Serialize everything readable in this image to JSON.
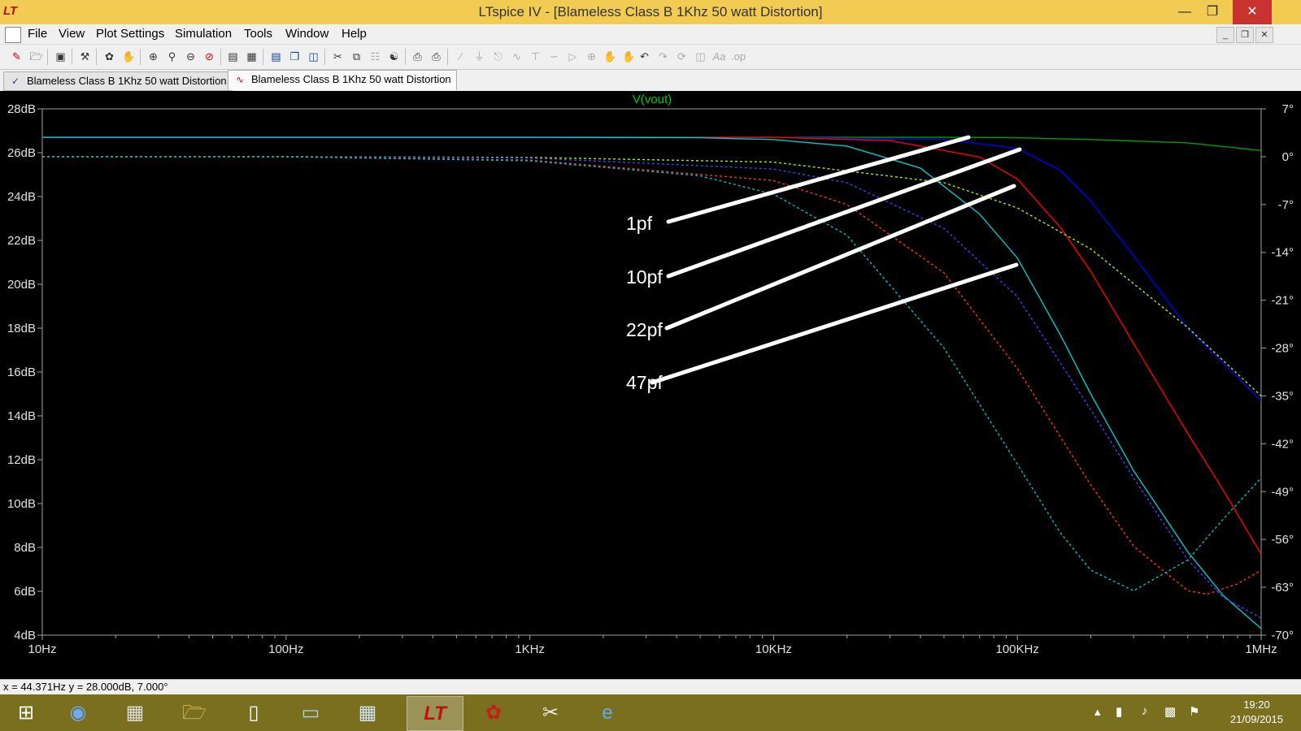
{
  "window": {
    "title": "LTspice IV - [Blameless Class B 1Khz 50 watt Distortion]",
    "logo_icon": "ltspice-logo-icon",
    "controls": [
      "minimize-icon",
      "maximize-icon",
      "close-icon"
    ]
  },
  "menu": {
    "items": [
      "File",
      "View",
      "Plot Settings",
      "Simulation",
      "Tools",
      "Window",
      "Help"
    ]
  },
  "toolbar": {
    "icons": [
      "new-schematic-icon",
      "open-icon",
      "save-icon",
      "control-panel-icon",
      "run-icon",
      "pan-icon",
      "zoom-in-icon",
      "zoom-area-icon",
      "zoom-out-icon",
      "zoom-cancel-icon",
      "autorange-icon",
      "grid-icon",
      "tile-horizontal-icon",
      "cascade-icon",
      "tile-vertical-icon",
      "cut-icon",
      "copy-icon",
      "paste-icon",
      "find-icon",
      "print-preview-icon",
      "print-icon",
      "wire-icon",
      "ground-icon",
      "label-icon",
      "resistor-icon",
      "capacitor-icon",
      "inductor-icon",
      "diode-icon",
      "component-icon",
      "move-icon",
      "drag-icon",
      "undo-icon",
      "redo-icon",
      "rotate-icon",
      "mirror-icon",
      "text-icon",
      "spice-directive-icon"
    ]
  },
  "tabs": [
    {
      "label": "Blameless Class B 1Khz 50 watt Distortion",
      "icon": "schematic-icon"
    },
    {
      "label": "Blameless Class B 1Khz 50 watt Distortion",
      "icon": "waveform-icon",
      "active": true
    }
  ],
  "plot": {
    "trace_label": "V(vout)",
    "annotations": [
      "1pf",
      "10pf",
      "22pf",
      "47pf"
    ]
  },
  "chart_data": {
    "type": "line",
    "title": "V(vout)",
    "x_scale": "log",
    "xlim_hz": [
      10,
      1000000
    ],
    "x_ticks": [
      "10Hz",
      "100Hz",
      "1KHz",
      "10KHz",
      "100KHz",
      "1MHz"
    ],
    "y_left_ticks": [
      "28dB",
      "26dB",
      "24dB",
      "22dB",
      "20dB",
      "18dB",
      "16dB",
      "14dB",
      "12dB",
      "10dB",
      "8dB",
      "6dB",
      "4dB"
    ],
    "y_left_range_db": [
      4,
      28
    ],
    "y_right_ticks": [
      "7°",
      "0°",
      "-7°",
      "-14°",
      "-21°",
      "-28°",
      "-35°",
      "-42°",
      "-49°",
      "-56°",
      "-63°",
      "-70°"
    ],
    "y_right_range_deg": [
      -70,
      7
    ],
    "grid": false,
    "series": [
      {
        "color": "#00A000",
        "kind": "magnitude",
        "axis": "left",
        "x": [
          10,
          1000,
          10000,
          50000,
          100000,
          200000,
          500000,
          1000000
        ],
        "y": [
          26.7,
          26.7,
          26.7,
          26.7,
          26.68,
          26.6,
          26.45,
          26.1
        ]
      },
      {
        "color": "#0000FF",
        "kind": "magnitude",
        "axis": "left",
        "x": [
          10,
          1000,
          10000,
          50000,
          100000,
          150000,
          200000,
          300000,
          500000,
          700000,
          1000000
        ],
        "y": [
          26.7,
          26.7,
          26.7,
          26.6,
          26.2,
          25.2,
          23.8,
          21.3,
          18.0,
          16.4,
          14.7
        ]
      },
      {
        "color": "#FF0000",
        "kind": "magnitude",
        "axis": "left",
        "x": [
          10,
          1000,
          10000,
          30000,
          70000,
          100000,
          150000,
          200000,
          300000,
          500000,
          700000,
          1000000
        ],
        "y": [
          26.7,
          26.7,
          26.7,
          26.55,
          25.8,
          24.8,
          22.6,
          20.6,
          17.3,
          13.2,
          10.6,
          7.7
        ]
      },
      {
        "color": "#00C8C8",
        "kind": "magnitude",
        "axis": "left",
        "x": [
          10,
          1000,
          5000,
          10000,
          20000,
          40000,
          70000,
          100000,
          150000,
          200000,
          300000,
          500000,
          700000,
          1000000
        ],
        "y": [
          26.7,
          26.7,
          26.68,
          26.6,
          26.3,
          25.3,
          23.2,
          21.2,
          17.7,
          15.0,
          11.5,
          7.8,
          5.8,
          4.3
        ]
      },
      {
        "color": "#A8F000",
        "kind": "phase",
        "axis": "right",
        "x": [
          10,
          100,
          1000,
          10000,
          50000,
          100000,
          200000,
          500000,
          1000000
        ],
        "y": [
          0,
          0,
          -0.1,
          -0.8,
          -3.8,
          -7.5,
          -13.5,
          -25.0,
          -35.0
        ]
      },
      {
        "color": "#4040FF",
        "kind": "phase",
        "axis": "right",
        "x": [
          10,
          100,
          1000,
          10000,
          20000,
          50000,
          100000,
          200000,
          300000,
          500000,
          700000,
          1000000
        ],
        "y": [
          0,
          0,
          -0.2,
          -1.8,
          -3.8,
          -10.5,
          -20.5,
          -37.0,
          -47.0,
          -59.0,
          -64.5,
          -67.5
        ]
      },
      {
        "color": "#FF3030",
        "kind": "phase",
        "axis": "right",
        "x": [
          10,
          100,
          1000,
          10000,
          20000,
          50000,
          100000,
          200000,
          300000,
          500000,
          600000,
          800000,
          1000000
        ],
        "y": [
          0,
          0,
          -0.5,
          -3.5,
          -7.0,
          -17.0,
          -31.0,
          -48.0,
          -57.0,
          -63.5,
          -64.0,
          -62.5,
          -60.5
        ]
      },
      {
        "color": "#00C0C0",
        "kind": "phase",
        "axis": "right",
        "x": [
          10,
          100,
          1000,
          5000,
          10000,
          20000,
          50000,
          100000,
          150000,
          200000,
          300000,
          500000,
          700000,
          1000000
        ],
        "y": [
          0,
          0,
          -0.6,
          -2.8,
          -5.5,
          -11.5,
          -28.0,
          -45.0,
          -55.0,
          -60.5,
          -63.5,
          -59.0,
          -53.0,
          -47.0
        ]
      }
    ]
  },
  "status": {
    "readout": "x = 44.371Hz    y = 28.000dB, 7.000°"
  },
  "taskbar": {
    "apps": [
      "start-icon",
      "remote-desktop-icon",
      "firewall-icon",
      "file-explorer-icon",
      "document-icon",
      "notepad-icon",
      "calculator-icon",
      "ltspice-icon",
      "games-icon",
      "snipping-tool-icon",
      "internet-explorer-icon"
    ],
    "active_app": "ltspice-icon",
    "tray": [
      "show-hidden-icons-icon",
      "battery-icon",
      "volume-icon",
      "signal-icon",
      "action-center-flag-icon"
    ],
    "time": "19:20",
    "date": "21/09/2015"
  }
}
